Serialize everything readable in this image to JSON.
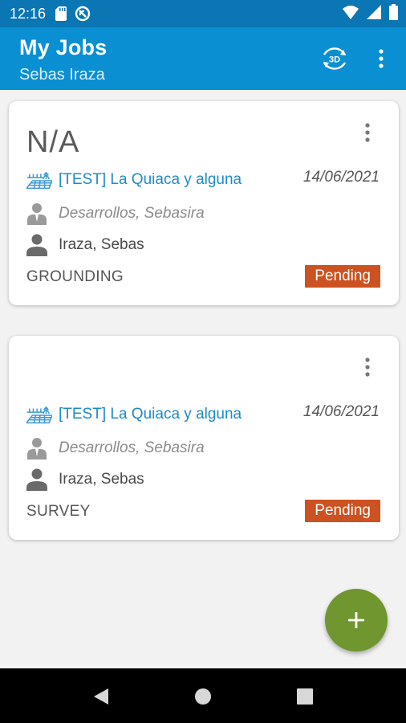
{
  "status_bar": {
    "time": "12:16",
    "left_icons": [
      "sd-card-icon",
      "sync-disabled-icon"
    ],
    "right_icons": [
      "wifi-icon",
      "signal-icon",
      "battery-icon"
    ]
  },
  "app_bar": {
    "title": "My Jobs",
    "subtitle": "Sebas Iraza",
    "actions": [
      {
        "icon": "view-3d-icon",
        "label": "3D"
      },
      {
        "icon": "more-vert-icon"
      }
    ]
  },
  "jobs": [
    {
      "name": "N/A",
      "project": "[TEST] La Quiaca y alguna",
      "date": "14/06/2021",
      "creator": "Desarrollos, Sebasira",
      "assignee": "Iraza, Sebas",
      "type": "GROUNDING",
      "status": "Pending"
    },
    {
      "name": "",
      "project": "[TEST] La Quiaca y alguna",
      "date": "14/06/2021",
      "creator": "Desarrollos, Sebasira",
      "assignee": "Iraza, Sebas",
      "type": "SURVEY",
      "status": "Pending"
    }
  ],
  "fab": {
    "icon": "plus-icon"
  },
  "nav_bar": {
    "buttons": [
      "back-icon",
      "home-icon",
      "recents-icon"
    ]
  },
  "colors": {
    "status_bar": "#0a76b3",
    "app_bar": "#0b8fd3",
    "link": "#1d8ac7",
    "pending_badge": "#cc5221",
    "fab": "#6f962f",
    "background": "#f2f2f2"
  }
}
